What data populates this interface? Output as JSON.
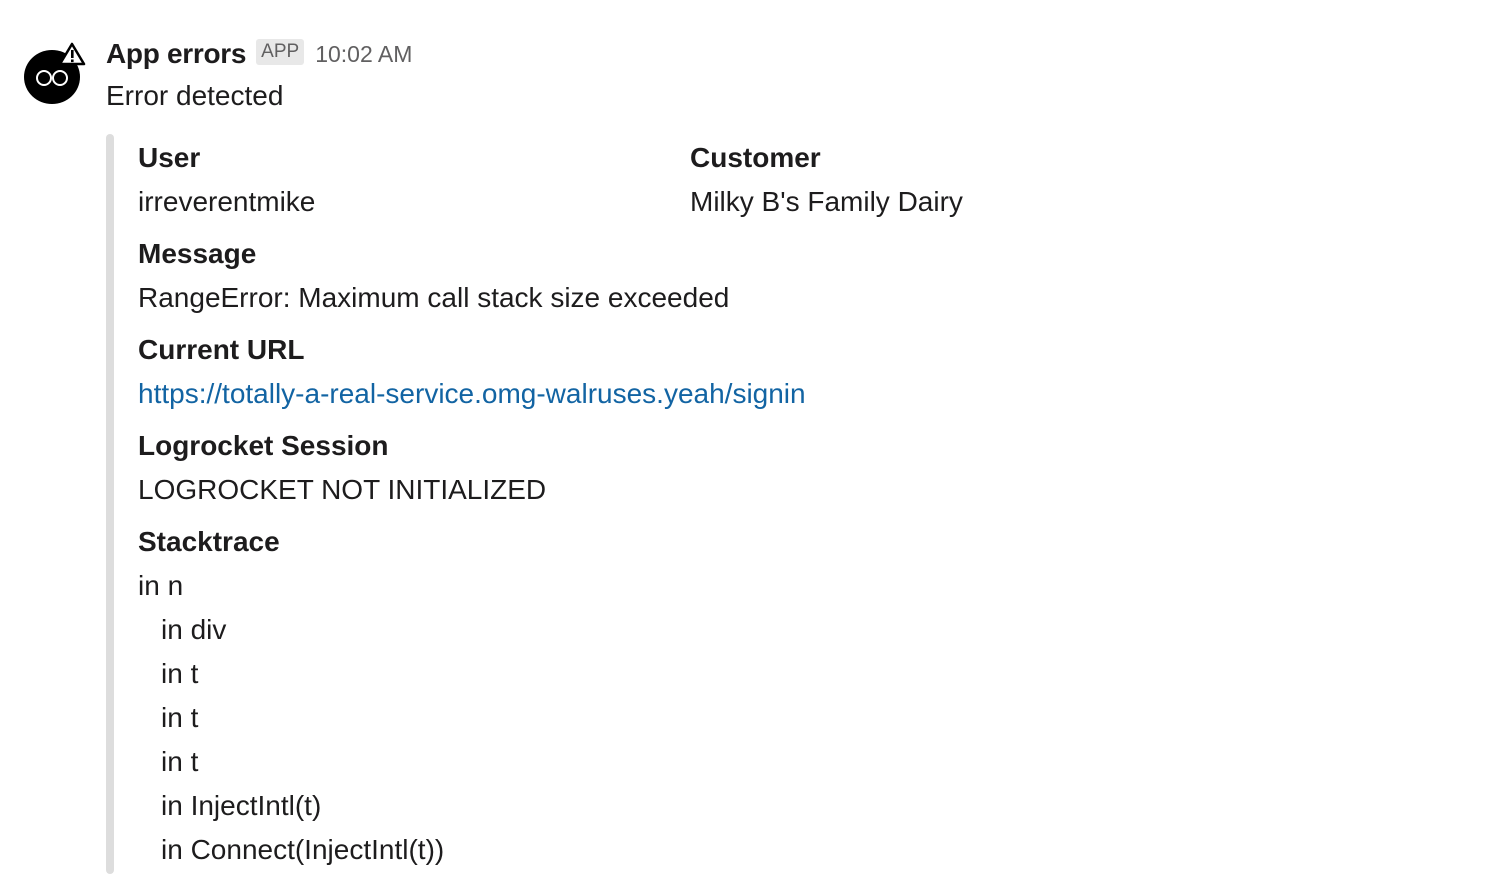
{
  "message": {
    "app_name": "App errors",
    "badge": "APP",
    "timestamp": "10:02 AM",
    "text": "Error detected"
  },
  "avatar": {
    "icon": "robot-warning-icon",
    "face_color": "#000000",
    "eye_color": "#ffffff"
  },
  "fields": {
    "user": {
      "title": "User",
      "value": "irreverentmike"
    },
    "customer": {
      "title": "Customer",
      "value": "Milky B's Family Dairy"
    },
    "message": {
      "title": "Message",
      "value": "RangeError: Maximum call stack size exceeded"
    },
    "current_url": {
      "title": "Current URL",
      "value": "https://totally-a-real-service.omg-walruses.yeah/signin"
    },
    "logrocket": {
      "title": "Logrocket Session",
      "value": "LOGROCKET NOT INITIALIZED"
    },
    "stacktrace": {
      "title": "Stacktrace",
      "lines": [
        "in n",
        "in div",
        "in t",
        "in t",
        "in t",
        "in InjectIntl(t)",
        "in Connect(InjectIntl(t))"
      ]
    }
  },
  "colors": {
    "link": "#1264a3",
    "attachment_bar": "#dddddd",
    "text": "#1d1c1d",
    "muted": "#616061"
  }
}
